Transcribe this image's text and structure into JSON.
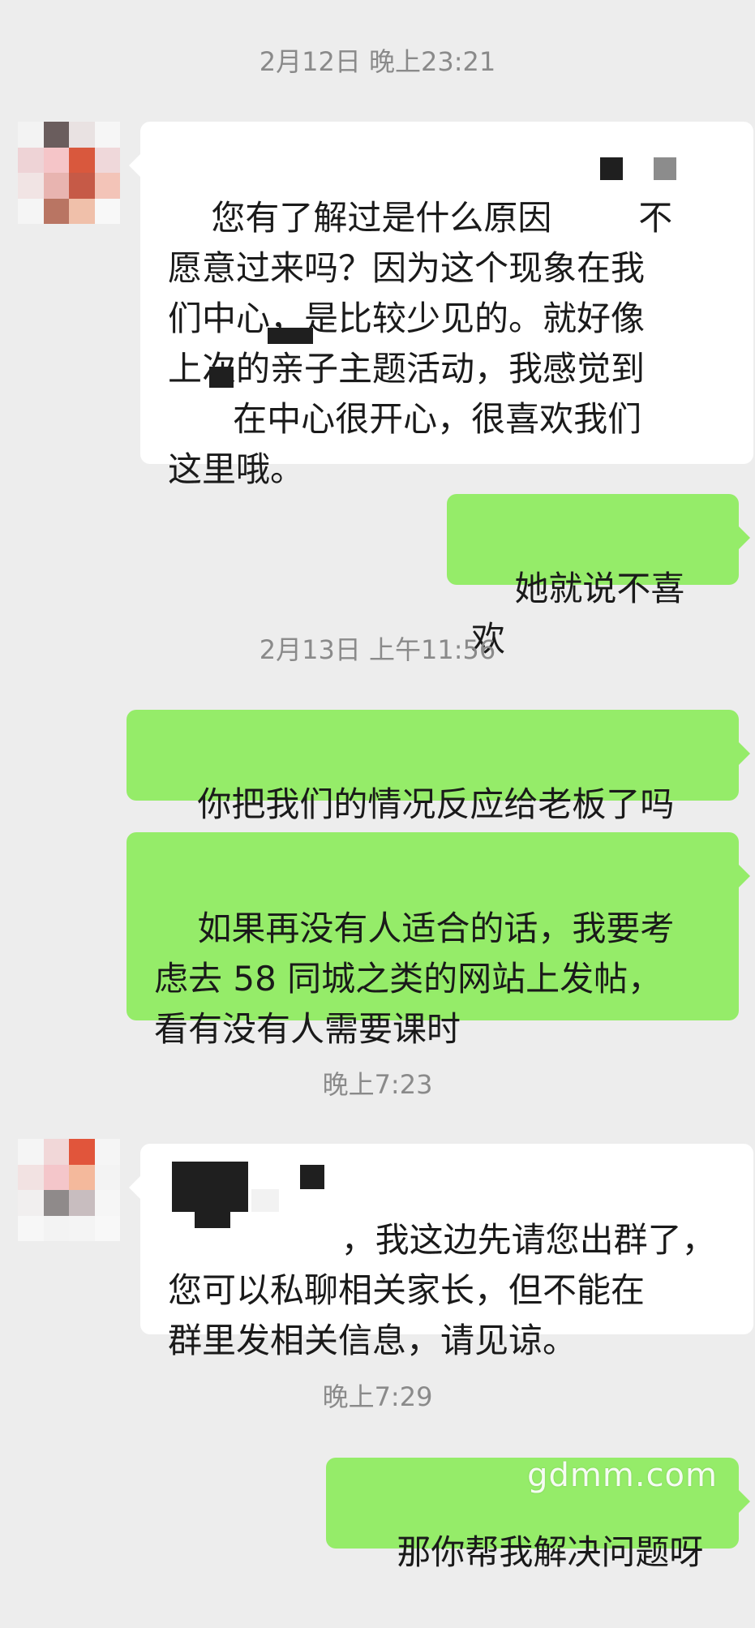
{
  "chat": {
    "timestamps": {
      "t1": "2月12日 晚上23:21",
      "t2": "2月13日 上午11:56",
      "t3": "晚上7:23",
      "t4": "晚上7:29"
    },
    "messages": {
      "m1": "您有了解过是什么原因        不\n愿意过来吗？因为这个现象在我\n们中心，是比较少见的。就好像\n上次的亲子主题活动，我感觉到\n      在中心很开心，很喜欢我们\n这里哦。",
      "m2": "她就说不喜欢",
      "m3": "你把我们的情况反应给老板了吗",
      "m4": "如果再没有人适合的话，我要考\n虑去 58 同城之类的网站上发帖，\n看有没有人需要课时",
      "m5": "            ，我这边先请您出群了，\n您可以私聊相关家长，但不能在\n群里发相关信息，请见谅。",
      "m6": "那你帮我解决问题呀"
    },
    "watermark": "gdmm.com"
  },
  "colors": {
    "background": "#ededed",
    "incoming_bubble": "#ffffff",
    "outgoing_bubble": "#95ec69",
    "timestamp_text": "#8a8a8a"
  },
  "icons": {
    "avatar": "contact-avatar-pixelated"
  }
}
